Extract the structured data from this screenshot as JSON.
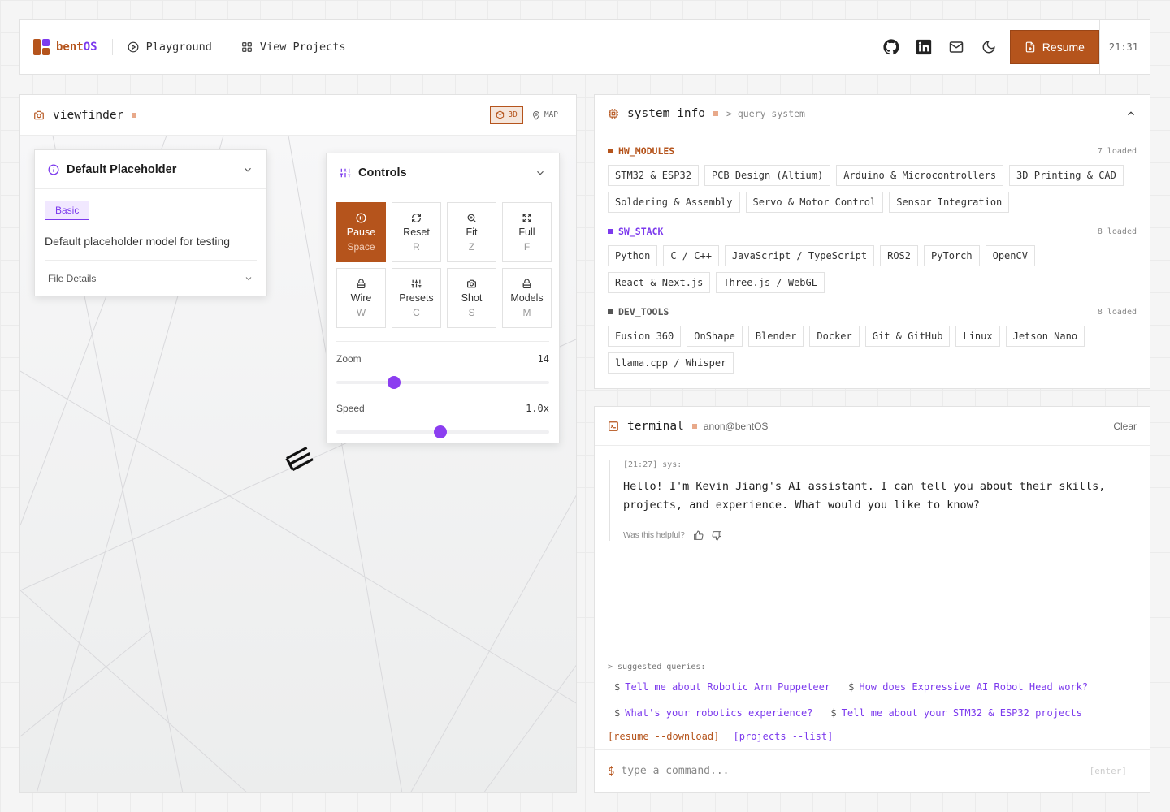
{
  "nav": {
    "brand_a": "bent",
    "brand_b": "OS",
    "links": [
      {
        "label": "Playground",
        "icon": "play-circle-icon"
      },
      {
        "label": "View Projects",
        "icon": "grid-icon"
      }
    ],
    "icons": [
      "github-icon",
      "linkedin-icon",
      "mail-icon",
      "moon-icon"
    ],
    "resume_label": "Resume",
    "clock": "21:31"
  },
  "viewfinder": {
    "title": "viewfinder",
    "mode_3d": "3D",
    "mode_map": "MAP",
    "model_card": {
      "title": "Default Placeholder",
      "tag": "Basic",
      "description": "Default placeholder model for testing",
      "file_details": "File Details"
    },
    "controls": {
      "title": "Controls",
      "buttons": [
        {
          "label": "Pause",
          "key": "Space",
          "icon": "pause-icon",
          "active": true
        },
        {
          "label": "Reset",
          "key": "R",
          "icon": "refresh-icon"
        },
        {
          "label": "Fit",
          "key": "Z",
          "icon": "zoom-in-icon"
        },
        {
          "label": "Full",
          "key": "F",
          "icon": "fullscreen-icon"
        },
        {
          "label": "Wire",
          "key": "W",
          "icon": "lock-icon"
        },
        {
          "label": "Presets",
          "key": "C",
          "icon": "sliders-icon"
        },
        {
          "label": "Shot",
          "key": "S",
          "icon": "camera-icon"
        },
        {
          "label": "Models",
          "key": "M",
          "icon": "box-icon"
        }
      ],
      "zoom": {
        "label": "Zoom",
        "value": "14",
        "fraction": 0.27
      },
      "speed": {
        "label": "Speed",
        "value": "1.0x",
        "fraction": 0.49
      }
    }
  },
  "system_info": {
    "title": "system info",
    "subtitle": "> query system",
    "sections": [
      {
        "name": "HW_MODULES",
        "loaded": "7 loaded",
        "color": "#b5541c",
        "items": [
          "STM32 & ESP32",
          "PCB Design (Altium)",
          "Arduino & Microcontrollers",
          "3D Printing & CAD",
          "Soldering & Assembly",
          "Servo & Motor Control",
          "Sensor Integration"
        ]
      },
      {
        "name": "SW_STACK",
        "loaded": "8 loaded",
        "color": "#7c3aed",
        "items": [
          "Python",
          "C / C++",
          "JavaScript / TypeScript",
          "ROS2",
          "PyTorch",
          "OpenCV",
          "React & Next.js",
          "Three.js / WebGL"
        ]
      },
      {
        "name": "DEV_TOOLS",
        "loaded": "8 loaded",
        "color": "#555555",
        "items": [
          "Fusion 360",
          "OnShape",
          "Blender",
          "Docker",
          "Git & GitHub",
          "Linux",
          "Jetson Nano",
          "llama.cpp / Whisper"
        ]
      }
    ]
  },
  "terminal": {
    "title": "terminal",
    "user": "anon@bentOS",
    "clear_label": "Clear",
    "message": {
      "meta": "[21:27] sys:",
      "text": "Hello! I'm Kevin Jiang's AI assistant. I can tell you about their skills, projects, and experience. What would you like to know?",
      "feedback": "Was this helpful?"
    },
    "suggest_label": "> suggested queries:",
    "suggestions_row1": [
      "Tell me about Robotic Arm Puppeteer",
      "How does Expressive AI Robot Head work?"
    ],
    "suggestions_row2": [
      "What's your robotics experience?",
      "Tell me about your STM32 & ESP32 projects"
    ],
    "cmd_resume": "[resume --download]",
    "cmd_projects": "[projects --list]",
    "input_prompt": "$",
    "input_placeholder": "type a command...",
    "enter_hint": "[enter]"
  },
  "colors": {
    "accent": "#b5541c",
    "purple": "#7c3aed"
  }
}
